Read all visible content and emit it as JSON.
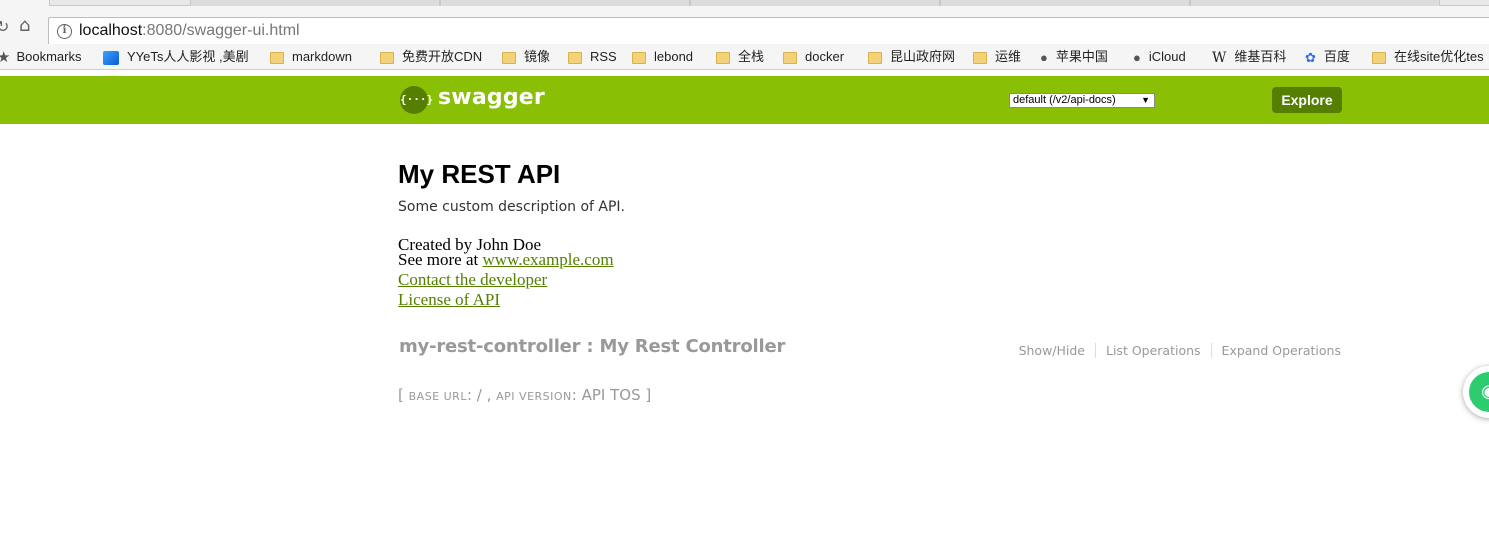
{
  "browser": {
    "url_host": "localhost",
    "url_rest": ":8080/swagger-ui.html",
    "bookmarks": [
      {
        "label": "Bookmarks",
        "icon": "star-icon"
      },
      {
        "label": "YYeTs人人影视 ,美剧",
        "icon": "yyets-icon"
      },
      {
        "label": "markdown",
        "icon": "folder-icon"
      },
      {
        "label": "免费开放CDN",
        "icon": "folder-icon"
      },
      {
        "label": "镜像",
        "icon": "folder-icon"
      },
      {
        "label": "RSS",
        "icon": "folder-icon"
      },
      {
        "label": "lebond",
        "icon": "folder-icon"
      },
      {
        "label": "全栈",
        "icon": "folder-icon"
      },
      {
        "label": "docker",
        "icon": "folder-icon"
      },
      {
        "label": "昆山政府网",
        "icon": "folder-icon"
      },
      {
        "label": "运维",
        "icon": "folder-icon"
      },
      {
        "label": "苹果中国",
        "icon": "apple-icon"
      },
      {
        "label": "iCloud",
        "icon": "apple-icon"
      },
      {
        "label": "维基百科",
        "icon": "wikipedia-icon"
      },
      {
        "label": "百度",
        "icon": "baidu-icon"
      },
      {
        "label": "在线site优化tes",
        "icon": "folder-icon"
      }
    ]
  },
  "header": {
    "logo_text": "swagger",
    "logo_glyph": "{···}",
    "spec_select_value": "default (/v2/api-docs)",
    "explore_label": "Explore",
    "bg_color": "#89bf04",
    "accent_color": "#547f00"
  },
  "info": {
    "title": "My REST API",
    "description": "Some custom description of API.",
    "created_by": "Created by John Doe",
    "see_more_prefix": "See more at ",
    "see_more_link": "www.example.com",
    "contact_link": "Contact the developer",
    "license_link": "License of API"
  },
  "resource": {
    "name": "my-rest-controller",
    "separator": " : ",
    "description": "My Rest Controller",
    "operations": [
      "Show/Hide",
      "List Operations",
      "Expand Operations"
    ]
  },
  "footer": {
    "open": "[ ",
    "base_url_label": "base url",
    "base_url_value": ": / , ",
    "api_version_label": "api version",
    "api_version_value": ": API TOS ]"
  }
}
